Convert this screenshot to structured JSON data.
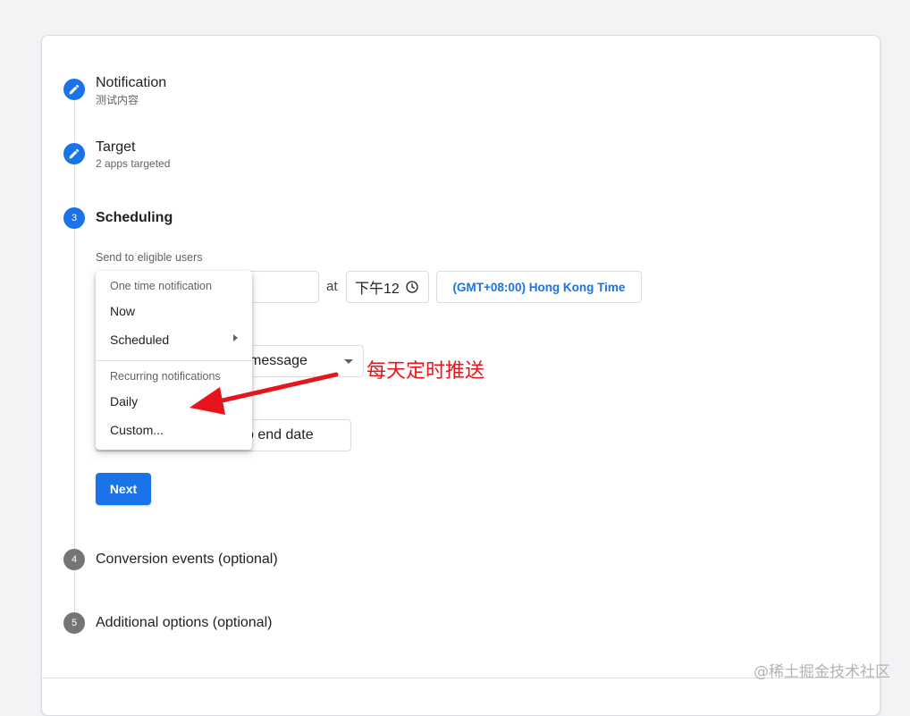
{
  "steps": [
    {
      "number": "",
      "title": "Notification",
      "subtitle": "测试内容"
    },
    {
      "number": "",
      "title": "Target",
      "subtitle": "2 apps targeted"
    },
    {
      "number": "3",
      "title": "Scheduling"
    },
    {
      "number": "4",
      "title": "Conversion events (optional)"
    },
    {
      "number": "5",
      "title": "Additional options (optional)"
    }
  ],
  "scheduling": {
    "send_label": "Send to eligible users",
    "at_label": "at",
    "time_value": "下午12",
    "timezone": "(GMT+08:00) Hong Kong Time",
    "frequency_value": "message",
    "end_value": "o end date",
    "next_button": "Next"
  },
  "menu": {
    "one_time_header": "One time notification",
    "now": "Now",
    "scheduled": "Scheduled",
    "recurring_header": "Recurring notifications",
    "daily": "Daily",
    "custom": "Custom..."
  },
  "annotation": "每天定时推送",
  "watermark": "@稀土掘金技术社区",
  "colors": {
    "accent": "#1a73e8",
    "annotation_red": "#e8141b",
    "step_inactive": "#757575"
  },
  "icons": [
    "pencil-icon",
    "clock-icon",
    "dropdown-arrow-icon",
    "chevron-right-icon",
    "annotation-arrow"
  ]
}
